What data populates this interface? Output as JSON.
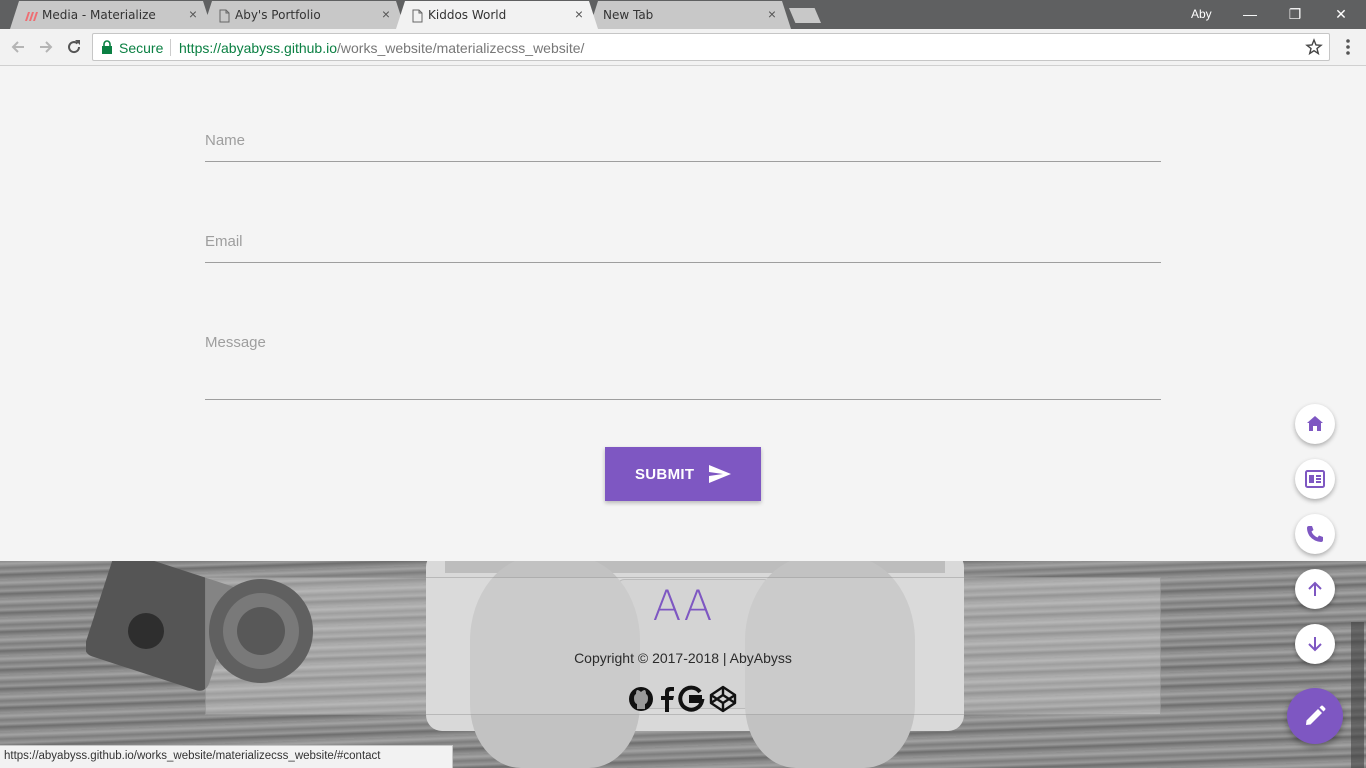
{
  "browser": {
    "tabs": [
      {
        "title": "Media - Materialize",
        "close": "×"
      },
      {
        "title": "Aby's Portfolio",
        "close": "×"
      },
      {
        "title": "Kiddos World",
        "close": "×"
      },
      {
        "title": "New Tab",
        "close": "×"
      }
    ],
    "active_tab_index": 2,
    "profile_name": "Aby",
    "window_controls": {
      "minimize": "—",
      "restore": "❐",
      "close": "✕"
    },
    "security_label": "Secure",
    "url_host": "https://abyabyss.github.io",
    "url_path": "/works_website/materializecss_website/",
    "status_url": "https://abyabyss.github.io/works_website/materializecss_website/#contact"
  },
  "form": {
    "name_label": "Name",
    "email_label": "Email",
    "message_label": "Message",
    "submit_label": "SUBMIT"
  },
  "footer": {
    "logo": "AA",
    "copyright": "Copyright © 2017-2018 | AbyAbyss",
    "social_icons": [
      "github-icon",
      "facebook-icon",
      "google-icon",
      "codepen-icon"
    ]
  },
  "floating_nav": {
    "buttons": [
      "home-icon",
      "news-icon",
      "phone-icon",
      "arrow-up-icon",
      "arrow-down-icon"
    ],
    "main_button": "pencil-icon"
  },
  "colors": {
    "accent": "#7e57c2",
    "page_background": "#f4f4f4",
    "secure_green": "#0b8043"
  }
}
